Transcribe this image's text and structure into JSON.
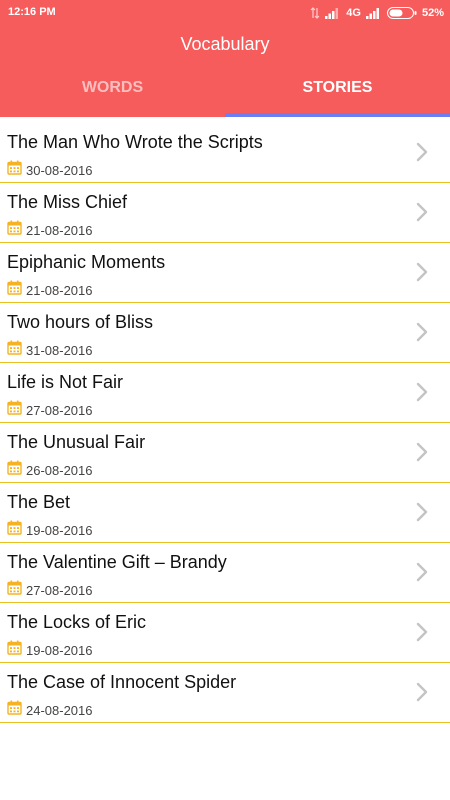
{
  "status_bar": {
    "time": "12:16 PM",
    "network": "4G",
    "battery": "52%"
  },
  "app": {
    "title": "Vocabulary"
  },
  "tabs": [
    {
      "label": "WORDS",
      "active": false
    },
    {
      "label": "STORIES",
      "active": true
    }
  ],
  "colors": {
    "header": "#f65c5c",
    "tab_indicator": "#6c7ef5",
    "row_divider": "#e8c020",
    "calendar_icon": "#f5b324"
  },
  "stories": [
    {
      "title": "The Man Who Wrote the Scripts",
      "date": "30-08-2016",
      "icon": "calendar-icon"
    },
    {
      "title": "The Miss Chief",
      "date": "21-08-2016",
      "icon": "calendar-icon"
    },
    {
      "title": "Epiphanic Moments",
      "date": "21-08-2016",
      "icon": "calendar-icon"
    },
    {
      "title": "Two hours of Bliss",
      "date": "31-08-2016",
      "icon": "calendar-icon"
    },
    {
      "title": "Life is Not Fair",
      "date": "27-08-2016",
      "icon": "calendar-icon"
    },
    {
      "title": "The Unusual Fair",
      "date": "26-08-2016",
      "icon": "calendar-icon"
    },
    {
      "title": "The Bet",
      "date": "19-08-2016",
      "icon": "calendar-icon"
    },
    {
      "title": "The Valentine Gift – Brandy",
      "date": "27-08-2016",
      "icon": "calendar-icon"
    },
    {
      "title": "The Locks of Eric",
      "date": "19-08-2016",
      "icon": "calendar-icon"
    },
    {
      "title": "The Case of Innocent Spider",
      "date": "24-08-2016",
      "icon": "calendar-icon"
    }
  ]
}
